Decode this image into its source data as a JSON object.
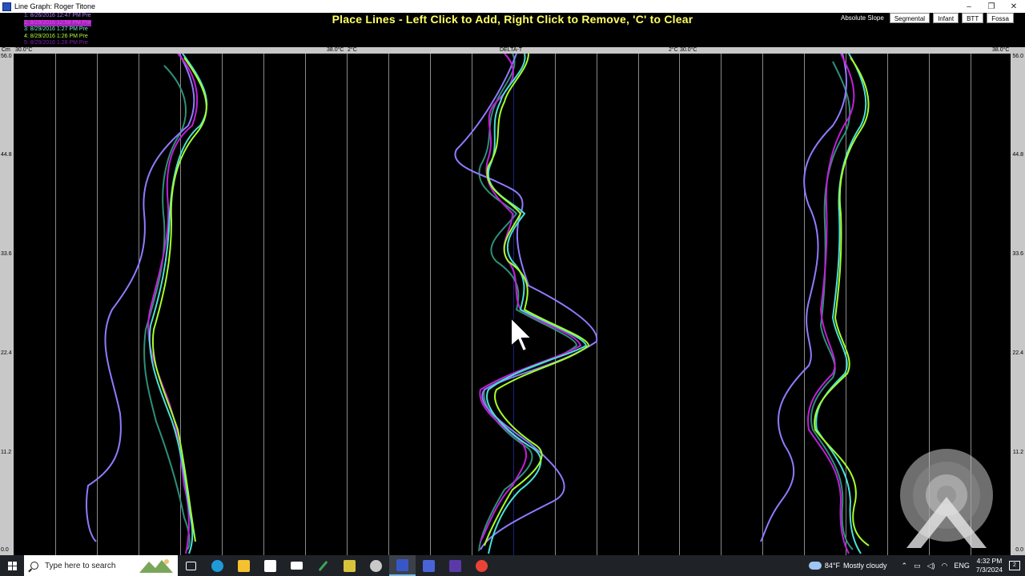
{
  "window": {
    "title": "Line Graph: Roger Titone",
    "controls": [
      "–",
      "❐",
      "✕"
    ]
  },
  "header": {
    "instruction": "Place Lines - Left Click to Add, Right Click to Remove, 'C' to Clear",
    "mode_label": "Absolute Slope",
    "mode_buttons": [
      "Segmental",
      "Infant",
      "BTT",
      "Fossa"
    ]
  },
  "legend": [
    {
      "label": "1: 8/26/2016 12:47 PM Pre",
      "color": "#b77cff"
    },
    {
      "label": "2: 8/29/2016 12:58 PM Pre",
      "color": "#ff38ff"
    },
    {
      "label": "3: 8/29/2016 1:27 PM Pre",
      "color": "#6cffc9"
    },
    {
      "label": "4: 8/29/2016 1:26 PM Pre",
      "color": "#b4ff3a"
    },
    {
      "label": "5: 8/29/2016 1:28 PM Pre",
      "color": "#7d22aa"
    }
  ],
  "scale": {
    "unit": "Cm",
    "left_min": "30.0°C",
    "left_max": "38.0°C",
    "delta_min": "2°C",
    "delta_label": "DELTA-T",
    "delta_max": "2°C",
    "right_min": "30.0°C",
    "right_max": "38.0°C"
  },
  "y_axis_labels": [
    "56.0",
    "44.8",
    "33.6",
    "22.4",
    "11.2",
    "0.0"
  ],
  "taskbar": {
    "search_placeholder": "Type here to search",
    "weather_temp": "84°F",
    "weather_text": "Mostly cloudy",
    "language": "ENG",
    "time": "4:32 PM",
    "date": "7/3/2024",
    "notifications": "2"
  },
  "colors": {
    "series_1": "#8f7bff",
    "series_2": "#c020d8",
    "series_3": "#4be0d8",
    "series_4": "#a6ff2a",
    "series_5": "#2e8f7a",
    "title_text": "#ffff66"
  },
  "chart_data": {
    "type": "line",
    "ylabel": "Cm",
    "ylim": [
      0,
      56
    ],
    "panels": [
      "left",
      "delta",
      "right"
    ],
    "series": [
      {
        "name": "1: 8/26/2016 12:47 PM Pre",
        "color": "#8f7bff"
      },
      {
        "name": "2: 8/29/2016 12:58 PM Pre",
        "color": "#c020d8"
      },
      {
        "name": "3: 8/29/2016 1:27 PM Pre",
        "color": "#4be0d8"
      },
      {
        "name": "4: 8/29/2016 1:26 PM Pre",
        "color": "#a6ff2a"
      },
      {
        "name": "5: 8/29/2016 1:28 PM Pre",
        "color": "#2e8f7a"
      }
    ]
  }
}
